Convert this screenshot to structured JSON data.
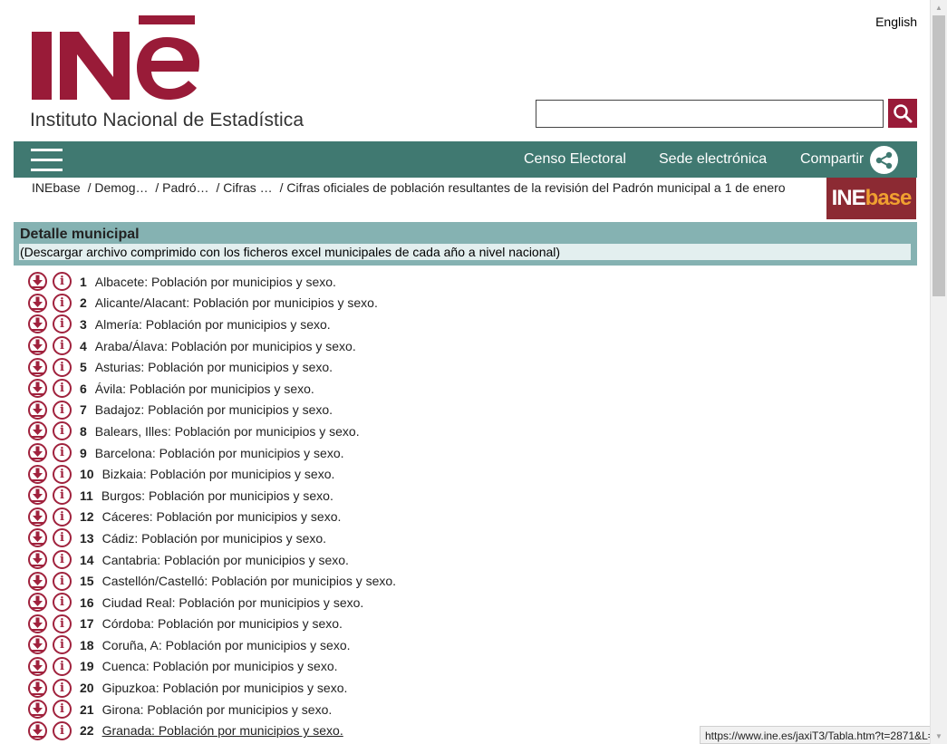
{
  "header": {
    "language_link": "English",
    "logo_text": "INE",
    "institute_name": "Instituto Nacional de Estadística"
  },
  "search": {
    "value": "",
    "placeholder": ""
  },
  "nav": {
    "links": [
      "Censo Electoral",
      "Sede electrónica",
      "Compartir"
    ]
  },
  "breadcrumb": [
    "INEbase",
    "/ Demog…",
    "/ Padró…",
    "/ Cifras …",
    "/ Cifras oficiales de población resultantes de la revisión del Padrón municipal a 1 de enero"
  ],
  "badge": {
    "ine": "INE",
    "base": "base"
  },
  "section": {
    "title": "Detalle municipal",
    "download_link": "(Descargar archivo comprimido con los ficheros excel municipales de cada año a nivel nacional)"
  },
  "items": [
    {
      "num": "1",
      "label": "Albacete: Población por municipios y sexo."
    },
    {
      "num": "2",
      "label": "Alicante/Alacant: Población por municipios y sexo."
    },
    {
      "num": "3",
      "label": "Almería: Población por municipios y sexo."
    },
    {
      "num": "4",
      "label": "Araba/Álava: Población por municipios y sexo."
    },
    {
      "num": "5",
      "label": "Asturias: Población por municipios y sexo."
    },
    {
      "num": "6",
      "label": "Ávila: Población por municipios y sexo."
    },
    {
      "num": "7",
      "label": "Badajoz: Población por municipios y sexo."
    },
    {
      "num": "8",
      "label": "Balears, Illes: Población por municipios y sexo."
    },
    {
      "num": "9",
      "label": "Barcelona: Población por municipios y sexo."
    },
    {
      "num": "10",
      "label": "Bizkaia: Población por municipios y sexo."
    },
    {
      "num": "11",
      "label": "Burgos: Población por municipios y sexo."
    },
    {
      "num": "12",
      "label": "Cáceres: Población por municipios y sexo."
    },
    {
      "num": "13",
      "label": "Cádiz: Población por municipios y sexo."
    },
    {
      "num": "14",
      "label": "Cantabria: Población por municipios y sexo."
    },
    {
      "num": "15",
      "label": "Castellón/Castelló: Población por municipios y sexo."
    },
    {
      "num": "16",
      "label": "Ciudad Real: Población por municipios y sexo."
    },
    {
      "num": "17",
      "label": "Córdoba: Población por municipios y sexo."
    },
    {
      "num": "18",
      "label": "Coruña, A: Población por municipios y sexo."
    },
    {
      "num": "19",
      "label": "Cuenca: Población por municipios y sexo."
    },
    {
      "num": "20",
      "label": "Gipuzkoa: Población por municipios y sexo."
    },
    {
      "num": "21",
      "label": "Girona: Población por municipios y sexo."
    },
    {
      "num": "22",
      "label": "Granada: Población por municipios y sexo.",
      "hovered": true
    }
  ],
  "status_url": "https://www.ine.es/jaxiT3/Tabla.htm?t=2871&L=0",
  "colors": {
    "brand": "#991b38",
    "nav": "#407971",
    "section": "#85b2b2",
    "section_sub": "#e3efef",
    "badge": "#8c2a33",
    "badge_accent": "#f0a030"
  },
  "icons": {
    "row_download": "download-circle-icon",
    "row_info": "info-circle-icon",
    "search": "magnifier-icon",
    "share": "share-icon",
    "menu": "hamburger-menu-icon"
  }
}
